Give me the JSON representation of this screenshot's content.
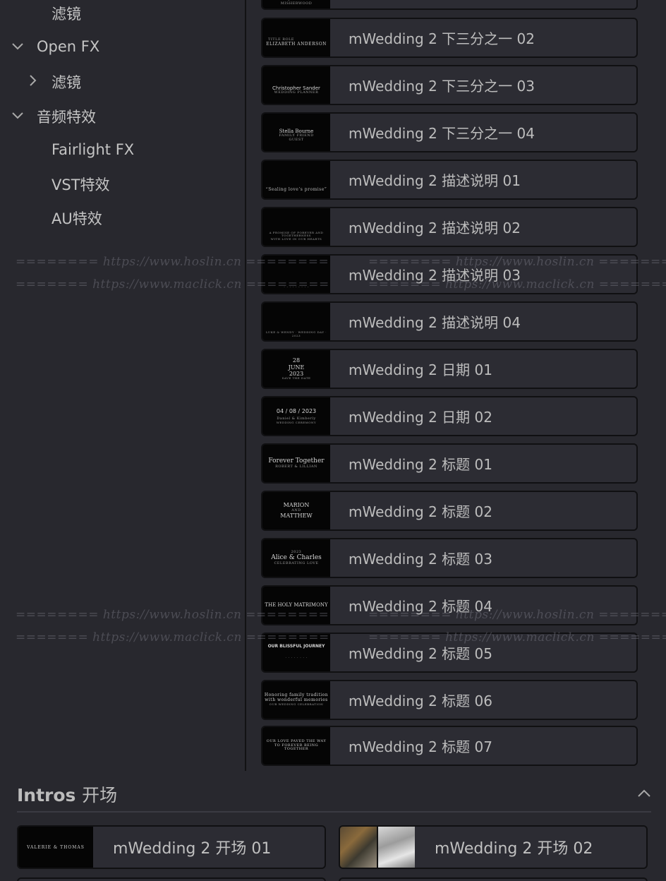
{
  "sidebar": {
    "items": [
      {
        "label": "滤镜"
      },
      {
        "label": "Open FX"
      },
      {
        "label": "滤镜"
      },
      {
        "label": "音频特效"
      },
      {
        "label": "Fairlight FX"
      },
      {
        "label": "VST特效"
      },
      {
        "label": "AU特效"
      }
    ]
  },
  "effects": {
    "items": [
      {
        "label": "mWedding 2 下三分之一 02",
        "thumb": [
          "TITLE ROLE",
          "ELIZABETH ANDERSON"
        ]
      },
      {
        "label": "mWedding 2 下三分之一 03",
        "thumb": [
          "Christopher Sander",
          "WEDDING PLANNER"
        ]
      },
      {
        "label": "mWedding 2 下三分之一 04",
        "thumb": [
          "Stella Bourne",
          "FAMILY FRIEND",
          "GUEST"
        ]
      },
      {
        "label": "mWedding 2 描述说明 01",
        "thumb": [
          "“Sealing love’s promise”"
        ]
      },
      {
        "label": "mWedding 2 描述说明 02",
        "thumb": [
          "A PROMISE OF FOREVER AND TOGETHERNESS",
          "WITH LOVE IN OUR HEARTS"
        ]
      },
      {
        "label": "mWedding 2 描述说明 03",
        "thumb": [
          "· · · · · · · · ·"
        ]
      },
      {
        "label": "mWedding 2 描述说明 04",
        "thumb": [
          "LUKE & WENDY · WEDDING DAY · 2023"
        ]
      },
      {
        "label": "mWedding 2 日期 01",
        "thumb": [
          "28",
          "JUNE",
          "2023",
          "SAVE THE DATE"
        ]
      },
      {
        "label": "mWedding 2 日期 02",
        "thumb": [
          "04 / 08 / 2023",
          "Daniel & Kimberly",
          "WEDDING CEREMONY"
        ]
      },
      {
        "label": "mWedding 2 标题 01",
        "thumb": [
          "Forever Together",
          "ROBERT & LILLIAN"
        ]
      },
      {
        "label": "mWedding 2 标题 02",
        "thumb": [
          "MARION",
          "AND",
          "MATTHEW"
        ]
      },
      {
        "label": "mWedding 2 标题 03",
        "thumb": [
          "2023",
          "Alice & Charles",
          "CELEBRATING LOVE"
        ]
      },
      {
        "label": "mWedding 2 标题 04",
        "thumb": [
          "THE HOLY MATRIMONY"
        ]
      },
      {
        "label": "mWedding 2 标题 05",
        "thumb": [
          "OUR BLISSFUL JOURNEY",
          "· · · · · · · ·"
        ]
      },
      {
        "label": "mWedding 2 标题 06",
        "thumb": [
          "Honoring family tradition",
          "with wonderful memories",
          "OUR WEDDING CELEBRATION"
        ]
      },
      {
        "label": "mWedding 2 标题 07",
        "thumb": [
          "OUR LOVE PAVED THE WAY",
          "TO FOREVER BEING TOGETHER"
        ]
      }
    ],
    "top_partial_thumb": "Reception Venue: MISHERWOOD"
  },
  "watermarks": {
    "line1": "======== https://www.hoslin.cn ========",
    "line2": "======= https://www.maclick.cn ========"
  },
  "intros": {
    "title": "Intros",
    "title_cn": "开场",
    "cards": [
      {
        "label": "mWedding 2 开场 01",
        "thumb": "VALERIE & THOMAS"
      },
      {
        "label": "mWedding 2 开场 02"
      }
    ]
  }
}
